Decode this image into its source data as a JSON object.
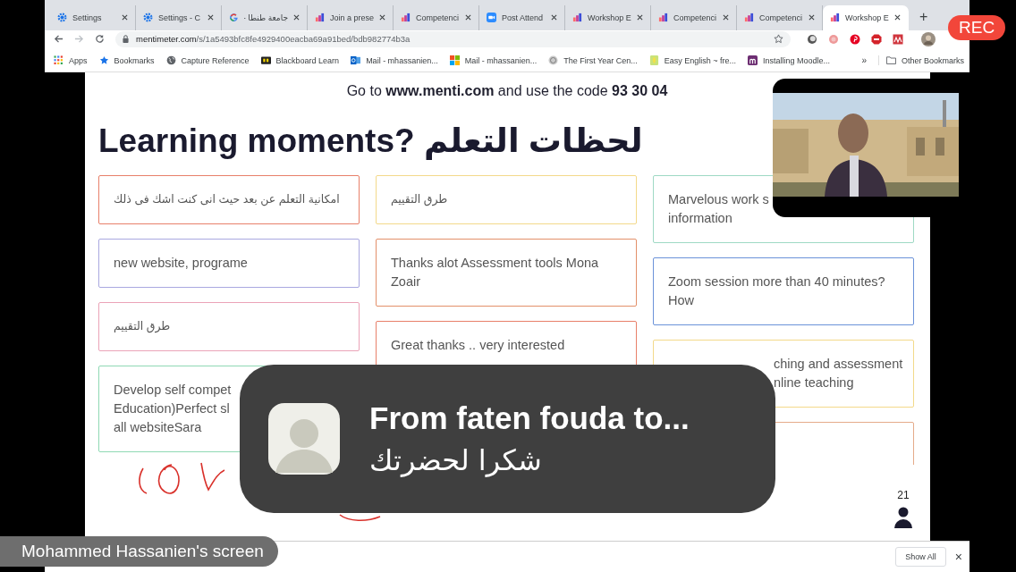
{
  "tabs": [
    {
      "label": "Settings",
      "kind": "settings",
      "selected": false
    },
    {
      "label": "Settings - C",
      "kind": "settings",
      "selected": false
    },
    {
      "label": "جامعة طنطا -",
      "kind": "google",
      "selected": false
    },
    {
      "label": "Join a prese",
      "kind": "mentimeter",
      "selected": false
    },
    {
      "label": "Competenci",
      "kind": "mentimeter",
      "selected": false
    },
    {
      "label": "Post Attend",
      "kind": "zoom",
      "selected": false
    },
    {
      "label": "Workshop E",
      "kind": "mentimeter",
      "selected": false
    },
    {
      "label": "Competenci",
      "kind": "mentimeter",
      "selected": false
    },
    {
      "label": "Competenci",
      "kind": "mentimeter",
      "selected": false
    },
    {
      "label": "Workshop E",
      "kind": "mentimeter",
      "selected": true
    }
  ],
  "new_tab": "+",
  "address": {
    "domain": "mentimeter.com",
    "path": "/s/1a5493bfc8fe4929400eacba69a91bed/bdb982774b3a"
  },
  "bookmarks": [
    {
      "label": "Apps",
      "kind": "apps"
    },
    {
      "label": "Bookmarks",
      "kind": "star"
    },
    {
      "label": "Capture Reference",
      "kind": "globe"
    },
    {
      "label": "Blackboard Learn",
      "kind": "blackboard"
    },
    {
      "label": "Mail - mhassanien...",
      "kind": "outlook"
    },
    {
      "label": "Mail - mhassanien...",
      "kind": "microsoft"
    },
    {
      "label": "The First Year Cen...",
      "kind": "seal"
    },
    {
      "label": "Easy English ~ fre...",
      "kind": "leaf"
    },
    {
      "label": "Installing Moodle...",
      "kind": "moodle"
    }
  ],
  "bookmarks_more": "»",
  "other_bookmarks": "Other Bookmarks",
  "slide": {
    "instruction": "Go to **www.menti.com** and use the code **93 30 04**",
    "title": "Learning moments? لحظات التعلم",
    "columns": [
      [
        {
          "lines": [
            "امكانية التعلم عن بعد حيث انى كنت اشك فى ذلك"
          ],
          "color": "#e8806a"
        },
        {
          "lines": [
            "new website, programe"
          ],
          "color": "#a9a8e0"
        },
        {
          "lines": [
            "طرق التقييم"
          ],
          "color": "#eba3b8"
        },
        {
          "lines": [
            "Develop self compet",
            "Education)Perfect sl",
            "all websiteSara"
          ],
          "color": "#8fd9b4"
        }
      ],
      [
        {
          "lines": [
            "طرق التقييم"
          ],
          "color": "#f3d98a"
        },
        {
          "lines": [
            "Thanks alot Assessment tools Mona",
            "Zoair"
          ],
          "color": "#e3906a"
        },
        {
          "lines": [
            "Great thanks .. very interested"
          ],
          "color": "#e8806a"
        }
      ],
      [
        {
          "lines": [
            "Marvelous work s",
            "information"
          ],
          "color": "#9ed9c4"
        },
        {
          "lines": [
            "Zoom session more than 40 minutes?",
            "How"
          ],
          "color": "#6b92d9"
        },
        {
          "lines": [
            "ching and assessment",
            "nline teaching"
          ],
          "color": "#f3d98a",
          "covered_left": true
        },
        {
          "color": "#e5ab8a"
        }
      ]
    ],
    "votes": "21"
  },
  "notification": {
    "title": "From faten fouda to...",
    "message": "شكرا لحضرتك"
  },
  "rec": "REC",
  "sharer": "Mohammed Hassanien's screen",
  "downloads": {
    "show_all": "Show All",
    "close": "×"
  }
}
